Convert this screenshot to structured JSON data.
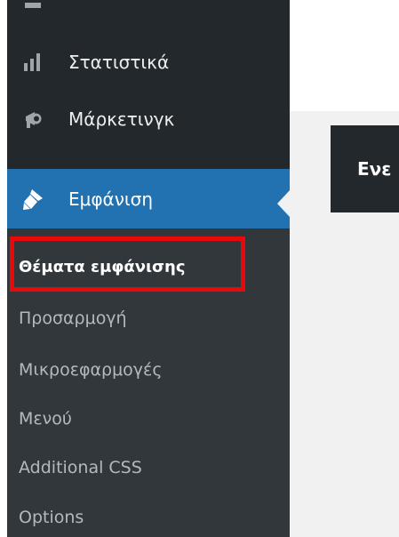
{
  "colors": {
    "sidebar_bg": "#23282d",
    "submenu_bg": "#32373c",
    "active_bg": "#2271b1",
    "highlight_border": "#e80a0a",
    "content_bg": "#f1f1f1"
  },
  "sidebar": {
    "items": [
      {
        "icon": "partial-menu-icon",
        "label": ""
      },
      {
        "icon": "stats-bars-icon",
        "label": "Στατιστικά"
      },
      {
        "icon": "megaphone-icon",
        "label": "Μάρκετινγκ"
      },
      {
        "icon": "paintbrush-icon",
        "label": "Εμφάνιση",
        "active": true
      }
    ],
    "submenu": [
      {
        "label": "Θέματα εμφάνισης",
        "active": true,
        "highlighted": true
      },
      {
        "label": "Προσαρμογή"
      },
      {
        "label": "Μικροεφαρμογές"
      },
      {
        "label": "Μενού"
      },
      {
        "label": "Additional CSS"
      },
      {
        "label": "Options"
      }
    ]
  },
  "content": {
    "partial_heading": "Ενε"
  }
}
